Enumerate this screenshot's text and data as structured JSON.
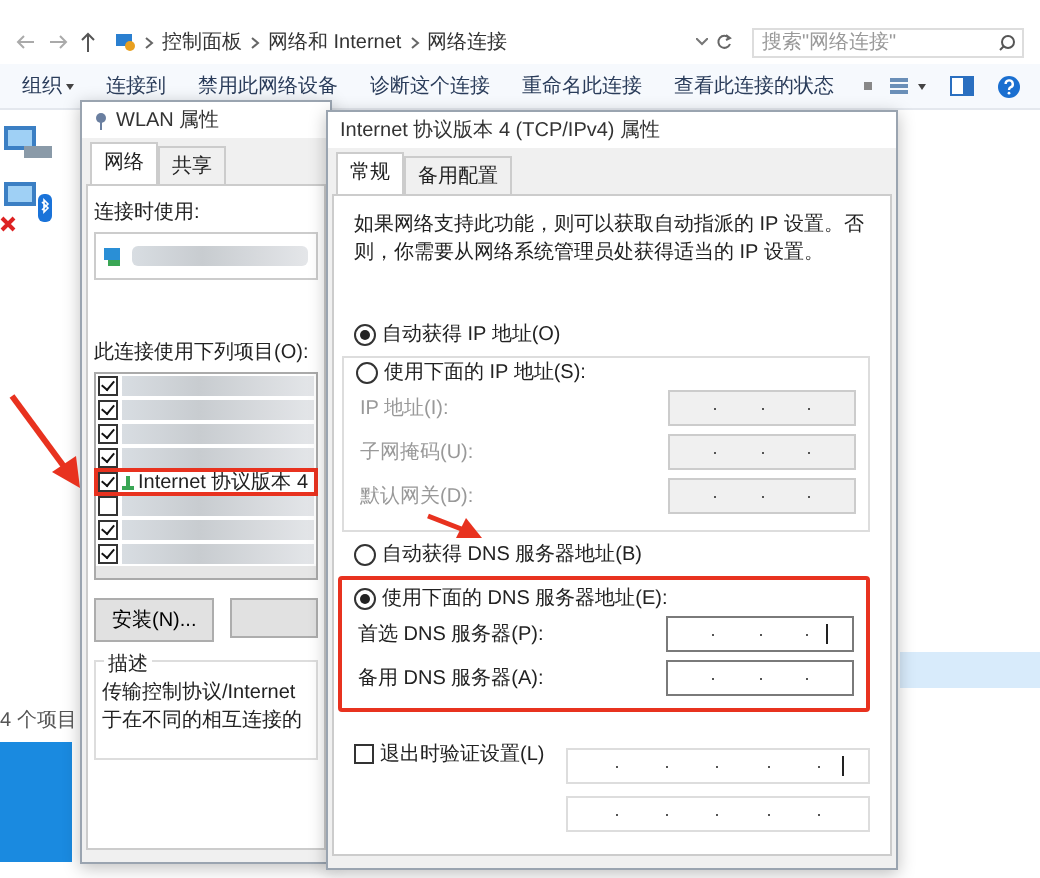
{
  "address_bar": {
    "breadcrumb": [
      "控制面板",
      "网络和 Internet",
      "网络连接"
    ]
  },
  "search": {
    "placeholder": "搜索\"网络连接\""
  },
  "toolbar": [
    {
      "label": "组织",
      "dropdown": true
    },
    {
      "label": "连接到",
      "dropdown": false
    },
    {
      "label": "禁用此网络设备",
      "dropdown": false
    },
    {
      "label": "诊断这个连接",
      "dropdown": false
    },
    {
      "label": "重命名此连接",
      "dropdown": false
    },
    {
      "label": "查看此连接的状态",
      "dropdown": false
    }
  ],
  "status_bar": {
    "count": "4 个项目"
  },
  "wlan_dialog": {
    "title": "WLAN 属性",
    "tabs": [
      {
        "label": "网络",
        "selected": true
      },
      {
        "label": "共享",
        "selected": false
      }
    ],
    "connect_label": "连接时使用:",
    "items_label": "此连接使用下列项目(O):",
    "items": [
      {
        "checked": true
      },
      {
        "checked": true
      },
      {
        "checked": true
      },
      {
        "checked": true
      },
      {
        "checked": true,
        "label": "Internet 协议版本 4",
        "highlighted": true
      },
      {
        "checked": false
      },
      {
        "checked": true
      },
      {
        "checked": true
      }
    ],
    "install_button": "安装(N)...",
    "description_title": "描述",
    "description": [
      "传输控制协议/Internet",
      "于在不同的相互连接的"
    ]
  },
  "ipv4_dialog": {
    "title": "Internet 协议版本 4 (TCP/IPv4) 属性",
    "tabs": [
      {
        "label": "常规",
        "selected": true
      },
      {
        "label": "备用配置",
        "selected": false
      }
    ],
    "intro": "如果网络支持此功能，则可以获取自动指派的 IP 设置。否则，你需要从网络系统管理员处获得适当的 IP 设置。",
    "ip_mode": [
      {
        "label": "自动获得 IP 地址(O)",
        "selected": true
      },
      {
        "label": "使用下面的 IP 地址(S):",
        "selected": false
      }
    ],
    "ip_fields": [
      {
        "label": "IP 地址(I):",
        "disabled": true
      },
      {
        "label": "子网掩码(U):",
        "disabled": true
      },
      {
        "label": "默认网关(D):",
        "disabled": true
      }
    ],
    "dns_mode": [
      {
        "label": "自动获得 DNS 服务器地址(B)",
        "selected": false
      },
      {
        "label": "使用下面的 DNS 服务器地址(E):",
        "selected": true
      }
    ],
    "dns_fields": [
      {
        "label": "首选 DNS 服务器(P):",
        "disabled": false,
        "focused": true
      },
      {
        "label": "备用 DNS 服务器(A):",
        "disabled": false,
        "focused": false
      }
    ],
    "validate": {
      "label": "退出时验证设置(L)",
      "checked": false
    }
  }
}
